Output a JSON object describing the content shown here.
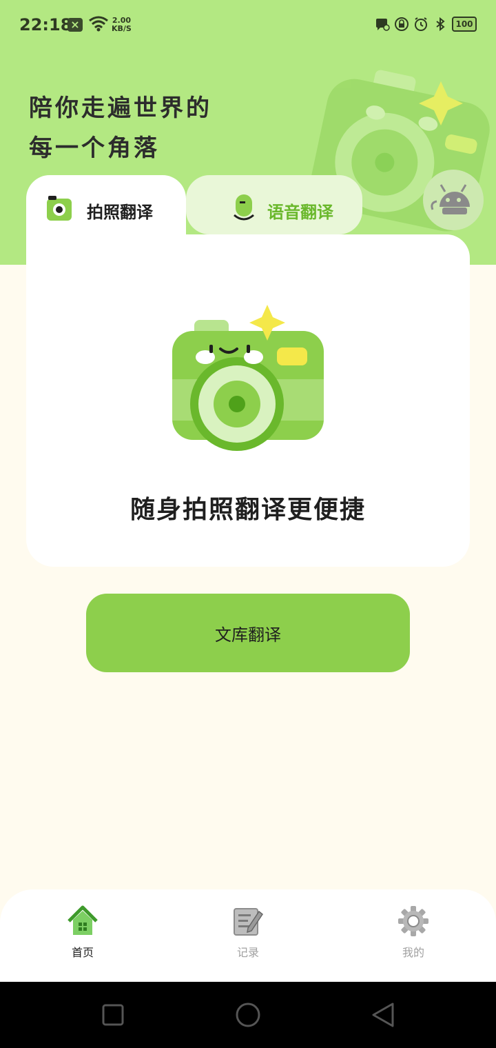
{
  "status_bar": {
    "time": "22:18",
    "net_speed_value": "2.00",
    "net_speed_unit": "KB/S",
    "battery": "100"
  },
  "header": {
    "slogan_line1": "陪你走遍世界的",
    "slogan_line2": "每一个角落"
  },
  "tabs": [
    {
      "label": "拍照翻译",
      "icon": "camera-icon",
      "active": true
    },
    {
      "label": "语音翻译",
      "icon": "voice-face-icon",
      "active": false
    }
  ],
  "card": {
    "caption": "随身拍照翻译更便捷"
  },
  "buttons": {
    "doc_translate": "文库翻译"
  },
  "bottom_nav": [
    {
      "label": "首页",
      "icon": "home-icon",
      "active": true
    },
    {
      "label": "记录",
      "icon": "notes-icon",
      "active": false
    },
    {
      "label": "我的",
      "icon": "gear-icon",
      "active": false
    }
  ],
  "colors": {
    "header_bg": "#b3e882",
    "accent": "#8dcf4c",
    "page_bg": "#fffbef",
    "inactive_tab_text": "#6ab82c"
  }
}
